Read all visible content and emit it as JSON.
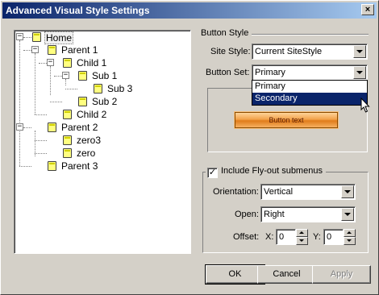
{
  "window": {
    "title": "Advanced Visual Style Settings",
    "close_label": "×"
  },
  "tree": {
    "nodes": [
      {
        "label": "Home",
        "expander": "−"
      },
      {
        "label": "Parent 1",
        "expander": "−"
      },
      {
        "label": "Child 1",
        "expander": "−"
      },
      {
        "label": "Sub 1",
        "expander": "−"
      },
      {
        "label": "Sub 3"
      },
      {
        "label": "Sub 2"
      },
      {
        "label": "Child 2"
      },
      {
        "label": "Parent 2",
        "expander": "−"
      },
      {
        "label": "zero3"
      },
      {
        "label": "zero"
      },
      {
        "label": "Parent 3"
      }
    ]
  },
  "button_style": {
    "group_title": "Button Style",
    "site_style_label": "Site Style:",
    "site_style_value": "Current SiteStyle",
    "button_set_label": "Button Set:",
    "button_set_value": "Primary",
    "button_set_options": [
      "Primary",
      "Secondary"
    ],
    "button_set_highlighted": "Secondary",
    "preview_button_text": "Button text"
  },
  "flyout": {
    "checkbox_label": "Include Fly-out submenus",
    "checked": true,
    "check_mark": "✓",
    "orientation_label": "Orientation:",
    "orientation_value": "Vertical",
    "open_label": "Open:",
    "open_value": "Right",
    "offset_label": "Offset:",
    "x_label": "X:",
    "x_value": "0",
    "y_label": "Y:",
    "y_value": "0"
  },
  "buttons": {
    "ok": "OK",
    "cancel": "Cancel",
    "apply": "Apply"
  }
}
